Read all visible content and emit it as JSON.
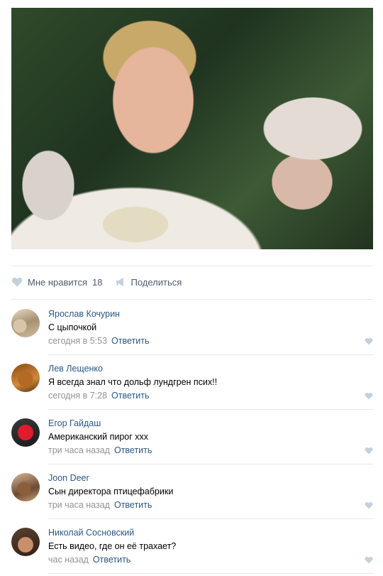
{
  "post": {
    "photo_alt": "",
    "like_label": "Мне нравится",
    "like_count": "18",
    "share_label": "Поделиться"
  },
  "comments": [
    {
      "author": "Ярослав Кочурин",
      "text": "С цыпочкой",
      "time": "сегодня в 5:53",
      "reply": "Ответить"
    },
    {
      "author": "Лев Лещенко",
      "text": "Я всегда знал что дольф лундгрен псих!!",
      "time": "сегодня в 7:28",
      "reply": "Ответить"
    },
    {
      "author": "Егор Гайдаш",
      "text": "Американский пирог ххх",
      "time": "три часа назад",
      "reply": "Ответить"
    },
    {
      "author": "Joon Deer",
      "text": "Сын директора птицефабрики",
      "time": "три часа назад",
      "reply": "Ответить"
    },
    {
      "author": "Николай Сосновский",
      "text": "Есть видео, где он её трахает?",
      "time": "час назад",
      "reply": "Ответить"
    }
  ],
  "colors": {
    "link": "#2a5885",
    "meta": "#939393",
    "icon": "#c5d0db",
    "divider": "#e7e8ec"
  },
  "icons": {
    "like": "heart-icon",
    "share": "megaphone-icon"
  }
}
